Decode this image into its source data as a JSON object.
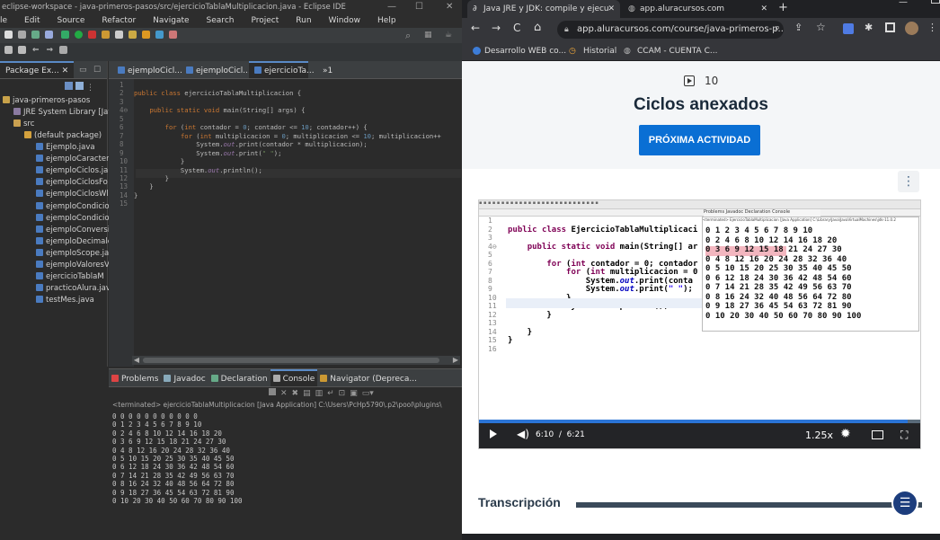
{
  "eclipse": {
    "title": "eclipse-workspace - java-primeros-pasos/src/ejercicioTablaMultiplicacion.java - Eclipse IDE",
    "menu": [
      "le",
      "Edit",
      "Source",
      "Refactor",
      "Navigate",
      "Search",
      "Project",
      "Run",
      "Window",
      "Help"
    ],
    "package_explorer": {
      "tab": "Package Ex...",
      "project": "java-primeros-pasos",
      "jre": "JRE System Library [Jav",
      "src": "src",
      "default_package": "(default package)",
      "files": [
        "Ejemplo.java",
        "ejemploCaracter",
        "ejemploCiclos.ja",
        "ejemploCiclosFo",
        "ejemploCiclosWl",
        "ejemploCondicio",
        "ejemploCondicio",
        "ejemploConversi",
        "ejemploDecimale",
        "ejemploScope.ja",
        "ejemploValoresV",
        "ejercicioTablaM",
        "practicoAlura.jav",
        "testMes.java"
      ]
    },
    "editor_tabs": [
      "ejemploCicl...",
      "ejemploCicl...",
      "ejercicioTa...",
      "»1"
    ],
    "code_lines": [
      {
        "n": "1",
        "t": ""
      },
      {
        "n": "2",
        "t": "public class ejercicioTablaMultiplicacion {"
      },
      {
        "n": "3",
        "t": ""
      },
      {
        "n": "4⊖",
        "t": "    public static void main(String[] args) {"
      },
      {
        "n": "5",
        "t": ""
      },
      {
        "n": "6",
        "t": "        for (int contador = 0; contador <= 10; contador++) {"
      },
      {
        "n": "7",
        "t": "            for (int multiplicacion = 0; multiplicacion <= 10; multiplicacion++"
      },
      {
        "n": "8",
        "t": "                System.out.print(contador * multiplicacion);"
      },
      {
        "n": "9",
        "t": "                System.out.print(\" \");"
      },
      {
        "n": "10",
        "t": "            }"
      },
      {
        "n": "11",
        "t": "            System.out.println();"
      },
      {
        "n": "12",
        "t": "        }"
      },
      {
        "n": "13",
        "t": "    }"
      },
      {
        "n": "14",
        "t": "}"
      },
      {
        "n": "15",
        "t": ""
      }
    ],
    "bottom_tabs": [
      "Problems",
      "Javadoc",
      "Declaration",
      "Console",
      "Navigator (Depreca..."
    ],
    "console_header": "<terminated> ejercicioTablaMultiplicacion [Java Application] C:\\Users\\PcHp5790\\.p2\\pool\\plugins\\",
    "console_lines": [
      "0 0 0 0 0 0 0 0 0 0 0",
      "0 1 2 3 4 5 6 7 8 9 10",
      "0 2 4 6 8 10 12 14 16 18 20",
      "0 3 6 9 12 15 18 21 24 27 30",
      "0 4 8 12 16 20 24 28 32 36 40",
      "0 5 10 15 20 25 30 35 40 45 50",
      "0 6 12 18 24 30 36 42 48 54 60",
      "0 7 14 21 28 35 42 49 56 63 70",
      "0 8 16 24 32 40 48 56 64 72 80",
      "0 9 18 27 36 45 54 63 72 81 90",
      "0 10 20 30 40 50 60 70 80 90 100"
    ]
  },
  "browser": {
    "tabs": [
      "Java JRE y JDK: compile y ejecu",
      "app.aluracursos.com"
    ],
    "url": "app.aluracursos.com/course/java-primeros-p...",
    "bookmarks": [
      "Desarrollo WEB co...",
      "Historial",
      "CCAM - CUENTA C..."
    ],
    "lesson_number": "10",
    "lesson_title": "Ciclos anexados",
    "next_button": "PRÓXIMA ACTIVIDAD",
    "video": {
      "code_lines": [
        {
          "n": "1",
          "t": ""
        },
        {
          "n": "2",
          "t": "public class EjercicioTablaMultiplicaci"
        },
        {
          "n": "3",
          "t": ""
        },
        {
          "n": "4⊖",
          "t": "    public static void main(String[] ar"
        },
        {
          "n": "5",
          "t": ""
        },
        {
          "n": "6",
          "t": "        for (int contador = 0; contador"
        },
        {
          "n": "7",
          "t": "            for (int multiplicacion = 0"
        },
        {
          "n": "8",
          "t": "                System.out.print(conta"
        },
        {
          "n": "9",
          "t": "                System.out.print(\" \");"
        },
        {
          "n": "10",
          "t": "            }"
        },
        {
          "n": "11",
          "t": "            System.out.println();"
        },
        {
          "n": "12",
          "t": "        }"
        },
        {
          "n": "13",
          "t": ""
        },
        {
          "n": "14",
          "t": "    }"
        },
        {
          "n": "15",
          "t": "}"
        },
        {
          "n": "16",
          "t": ""
        }
      ],
      "console_lines": [
        "0 1 2 3 4 5 6 7 8 9 10",
        "0 2 4 6 8 10 12 14 16 18 20",
        "0 3 6 9 12 15 18 21 24 27 30",
        "0 4 8 12 16 20 24 28 32 36 40",
        "0 5 10 15 20 25 30 35 40 45 50",
        "0 6 12 18 24 30 36 42 48 54 60",
        "0 7 14 21 28 35 42 49 56 63 70",
        "0 8 16 24 32 40 48 56 64 72 80",
        "0 9 18 27 36 45 54 63 72 81 90",
        "0 10 20 30 40 50 60 70 80 90 100"
      ],
      "time": "6:10  /  6:21",
      "speed": "1.25x",
      "progress": 0.971
    },
    "transcript_label": "Transcripción"
  },
  "colors": {
    "alura_blue": "#0a6fd4",
    "eclipse_bg": "#2b2b2b",
    "chrome_dark": "#202124"
  }
}
